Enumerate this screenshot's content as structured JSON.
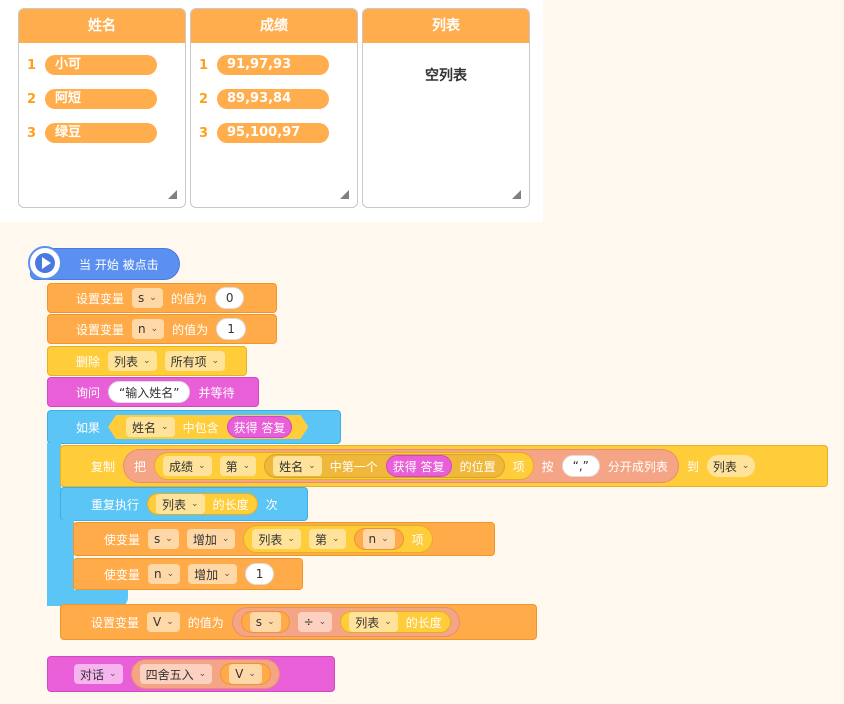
{
  "monitors": [
    {
      "title": "姓名",
      "items": [
        "小可",
        "阿短",
        "绿豆"
      ]
    },
    {
      "title": "成绩",
      "items": [
        "91,97,93",
        "89,93,84",
        "95,100,97"
      ]
    },
    {
      "title": "列表",
      "empty_text": "空列表"
    }
  ],
  "indices": [
    "1",
    "2",
    "3"
  ],
  "blocks": {
    "hat": "当 开始 被点击",
    "set_s": {
      "label": "设置变量",
      "var": "s",
      "mid": "的值为",
      "value": "0"
    },
    "set_n": {
      "label": "设置变量",
      "var": "n",
      "mid": "的值为",
      "value": "1"
    },
    "delete": {
      "label": "删除",
      "list": "列表",
      "which": "所有项"
    },
    "ask": {
      "label": "询问",
      "text": "“输入姓名”",
      "tail": "并等待"
    },
    "if": {
      "label": "如果",
      "list": "姓名",
      "mid": "中包含",
      "answer": "获得 答复"
    },
    "copy": {
      "label": "复制",
      "ba": "把",
      "list": "成绩",
      "di": "第",
      "list2": "姓名",
      "first": "中第一个",
      "answer": "获得 答复",
      "pos": "的位置",
      "xiang": "项",
      "an": "按",
      "sep": "“,”",
      "split": "分开成列表",
      "dao": "到",
      "target": "列表"
    },
    "repeat": {
      "label": "重复执行",
      "list": "列表",
      "len": "的长度",
      "ci": "次"
    },
    "inc_s": {
      "label": "使变量",
      "var": "s",
      "op": "增加",
      "list": "列表",
      "di": "第",
      "idx": "n",
      "xiang": "项"
    },
    "inc_n": {
      "label": "使变量",
      "var": "n",
      "op": "增加",
      "value": "1"
    },
    "set_v": {
      "label": "设置变量",
      "var": "V",
      "mid": "的值为",
      "a": "s",
      "div": "÷",
      "list": "列表",
      "len": "的长度"
    },
    "say": {
      "label": "对话",
      "round": "四舍五入",
      "var": "V"
    }
  },
  "colors": {
    "event": "#5b8ff0",
    "variable": "#ffab4a",
    "list": "#ffcc3a",
    "sensing": "#e95fd8",
    "control": "#5bc5f5",
    "operator": "#f5a585",
    "monitor_header": "#ffad4d",
    "canvas": "#fff8ee"
  },
  "icons": {
    "start": "play-icon",
    "dropdown": "chevron-down-icon",
    "resize": "resize-handle-icon"
  }
}
